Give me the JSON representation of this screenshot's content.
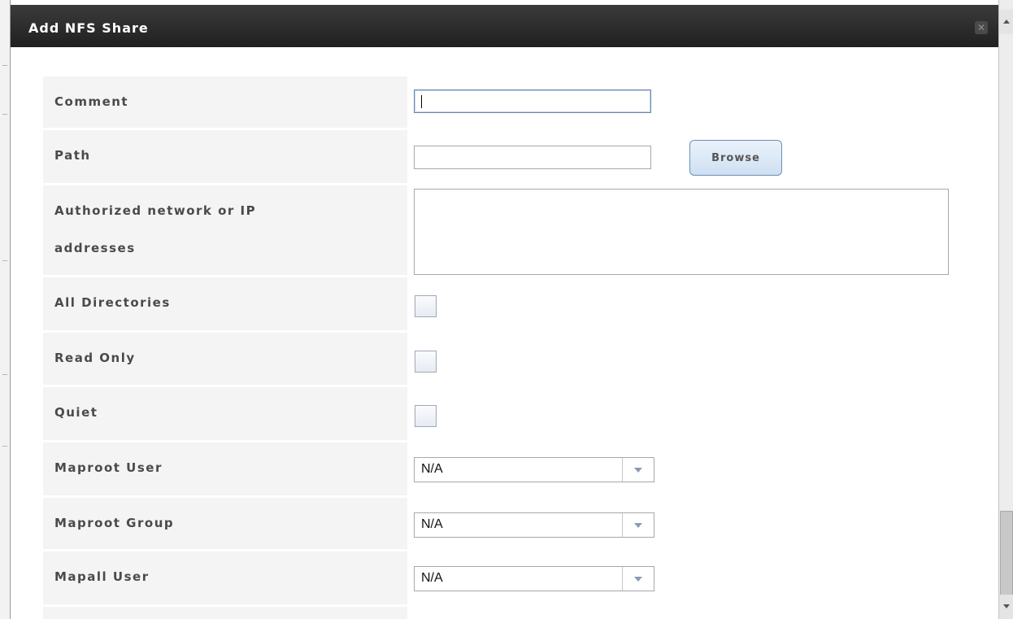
{
  "dialog": {
    "title": "Add NFS Share",
    "close_icon": "close-icon"
  },
  "form": {
    "comment": {
      "label": "Comment",
      "value": ""
    },
    "path": {
      "label": "Path",
      "value": "",
      "browse_label": "Browse"
    },
    "authorized_networks": {
      "label_line1": "Authorized network or IP",
      "label_line2": "addresses",
      "value": ""
    },
    "all_directories": {
      "label": "All Directories",
      "checked": false
    },
    "read_only": {
      "label": "Read Only",
      "checked": false
    },
    "quiet": {
      "label": "Quiet",
      "checked": false
    },
    "maproot_user": {
      "label": "Maproot User",
      "value": "N/A"
    },
    "maproot_group": {
      "label": "Maproot Group",
      "value": "N/A"
    },
    "mapall_user": {
      "label": "Mapall User",
      "value": "N/A"
    }
  },
  "icons": {
    "dropdown": "chevron-down-icon",
    "scroll_up": "arrow-up-icon",
    "scroll_down": "arrow-down-icon"
  },
  "colors": {
    "titlebar": "#2a2a2a",
    "label_background": "#f4f4f4",
    "button_border": "#6d8fb8"
  }
}
